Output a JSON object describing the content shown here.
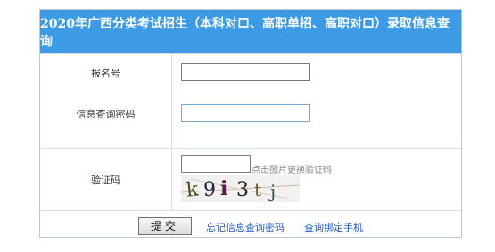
{
  "header": {
    "title": "2020年广西分类考试招生（本科对口、高职单招、高职对口）录取信息查询"
  },
  "form": {
    "exam_number_label": "报名号",
    "password_label": "信息查询密码",
    "captcha_label": "验证码",
    "exam_number_value": "",
    "password_value": "",
    "captcha_value": "",
    "captcha_hint": "点击图片更换验证码",
    "captcha_text": "k9i3tj"
  },
  "actions": {
    "submit_label": "提交",
    "forgot_password_link": "忘记信息查询密码",
    "bind_phone_link": "查询绑定手机"
  },
  "colors": {
    "header_bg": "#3d9be6",
    "link": "#1f57c4"
  }
}
